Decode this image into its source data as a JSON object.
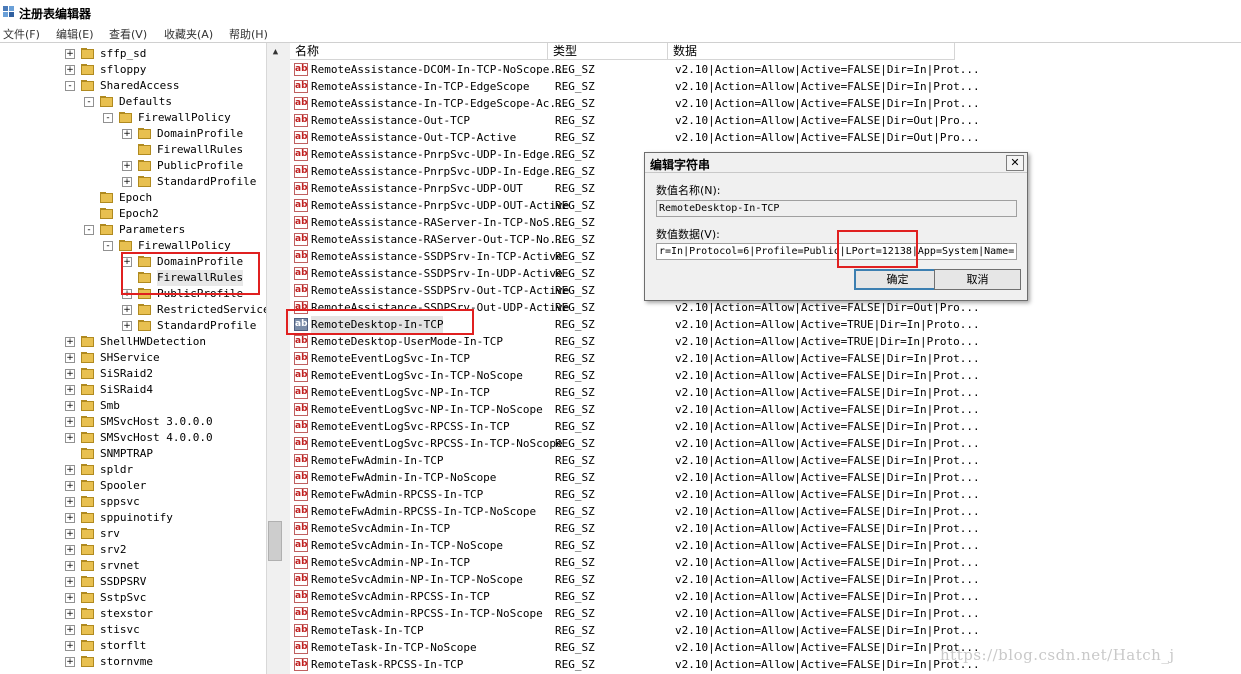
{
  "window": {
    "title": "注册表编辑器"
  },
  "menu": [
    {
      "label": "文件(F)"
    },
    {
      "label": "编辑(E)"
    },
    {
      "label": "查看(V)"
    },
    {
      "label": "收藏夹(A)"
    },
    {
      "label": "帮助(H)"
    }
  ],
  "tree": [
    {
      "label": "sffp_sd",
      "level": 0,
      "expander": "+"
    },
    {
      "label": "sfloppy",
      "level": 0,
      "expander": "+"
    },
    {
      "label": "SharedAccess",
      "level": 0,
      "expander": "-"
    },
    {
      "label": "Defaults",
      "level": 1,
      "expander": "-"
    },
    {
      "label": "FirewallPolicy",
      "level": 2,
      "expander": "-"
    },
    {
      "label": "DomainProfile",
      "level": 3,
      "expander": "+"
    },
    {
      "label": "FirewallRules",
      "level": 3,
      "expander": ""
    },
    {
      "label": "PublicProfile",
      "level": 3,
      "expander": "+"
    },
    {
      "label": "StandardProfile",
      "level": 3,
      "expander": "+"
    },
    {
      "label": "Epoch",
      "level": 1,
      "expander": ""
    },
    {
      "label": "Epoch2",
      "level": 1,
      "expander": ""
    },
    {
      "label": "Parameters",
      "level": 1,
      "expander": "-"
    },
    {
      "label": "FirewallPolicy",
      "level": 2,
      "expander": "-"
    },
    {
      "label": "DomainProfile",
      "level": 3,
      "expander": "+"
    },
    {
      "label": "FirewallRules",
      "level": 3,
      "expander": "",
      "selected": true
    },
    {
      "label": "PublicProfile",
      "level": 3,
      "expander": "+"
    },
    {
      "label": "RestrictedServices",
      "level": 3,
      "expander": "+"
    },
    {
      "label": "StandardProfile",
      "level": 3,
      "expander": "+"
    },
    {
      "label": "ShellHWDetection",
      "level": 0,
      "expander": "+"
    },
    {
      "label": "SHService",
      "level": 0,
      "expander": "+"
    },
    {
      "label": "SiSRaid2",
      "level": 0,
      "expander": "+"
    },
    {
      "label": "SiSRaid4",
      "level": 0,
      "expander": "+"
    },
    {
      "label": "Smb",
      "level": 0,
      "expander": "+"
    },
    {
      "label": "SMSvcHost 3.0.0.0",
      "level": 0,
      "expander": "+"
    },
    {
      "label": "SMSvcHost 4.0.0.0",
      "level": 0,
      "expander": "+"
    },
    {
      "label": "SNMPTRAP",
      "level": 0,
      "expander": ""
    },
    {
      "label": "spldr",
      "level": 0,
      "expander": "+"
    },
    {
      "label": "Spooler",
      "level": 0,
      "expander": "+"
    },
    {
      "label": "sppsvc",
      "level": 0,
      "expander": "+"
    },
    {
      "label": "sppuinotify",
      "level": 0,
      "expander": "+"
    },
    {
      "label": "srv",
      "level": 0,
      "expander": "+"
    },
    {
      "label": "srv2",
      "level": 0,
      "expander": "+"
    },
    {
      "label": "srvnet",
      "level": 0,
      "expander": "+"
    },
    {
      "label": "SSDPSRV",
      "level": 0,
      "expander": "+"
    },
    {
      "label": "SstpSvc",
      "level": 0,
      "expander": "+"
    },
    {
      "label": "stexstor",
      "level": 0,
      "expander": "+"
    },
    {
      "label": "stisvc",
      "level": 0,
      "expander": "+"
    },
    {
      "label": "storflt",
      "level": 0,
      "expander": "+"
    },
    {
      "label": "stornvme",
      "level": 0,
      "expander": "+"
    }
  ],
  "columns": {
    "name": "名称",
    "type": "类型",
    "data": "数据"
  },
  "values": [
    {
      "name": "RemoteAssistance-DCOM-In-TCP-NoScope...",
      "type": "REG_SZ",
      "data": "v2.10|Action=Allow|Active=FALSE|Dir=In|Prot..."
    },
    {
      "name": "RemoteAssistance-In-TCP-EdgeScope",
      "type": "REG_SZ",
      "data": "v2.10|Action=Allow|Active=FALSE|Dir=In|Prot..."
    },
    {
      "name": "RemoteAssistance-In-TCP-EdgeScope-Ac...",
      "type": "REG_SZ",
      "data": "v2.10|Action=Allow|Active=FALSE|Dir=In|Prot..."
    },
    {
      "name": "RemoteAssistance-Out-TCP",
      "type": "REG_SZ",
      "data": "v2.10|Action=Allow|Active=FALSE|Dir=Out|Pro..."
    },
    {
      "name": "RemoteAssistance-Out-TCP-Active",
      "type": "REG_SZ",
      "data": "v2.10|Action=Allow|Active=FALSE|Dir=Out|Pro..."
    },
    {
      "name": "RemoteAssistance-PnrpSvc-UDP-In-Edge...",
      "type": "REG_SZ",
      "data": ""
    },
    {
      "name": "RemoteAssistance-PnrpSvc-UDP-In-Edge...",
      "type": "REG_SZ",
      "data": ""
    },
    {
      "name": "RemoteAssistance-PnrpSvc-UDP-OUT",
      "type": "REG_SZ",
      "data": ""
    },
    {
      "name": "RemoteAssistance-PnrpSvc-UDP-OUT-Active",
      "type": "REG_SZ",
      "data": ""
    },
    {
      "name": "RemoteAssistance-RAServer-In-TCP-NoS...",
      "type": "REG_SZ",
      "data": ""
    },
    {
      "name": "RemoteAssistance-RAServer-Out-TCP-No...",
      "type": "REG_SZ",
      "data": ""
    },
    {
      "name": "RemoteAssistance-SSDPSrv-In-TCP-Active",
      "type": "REG_SZ",
      "data": ""
    },
    {
      "name": "RemoteAssistance-SSDPSrv-In-UDP-Active",
      "type": "REG_SZ",
      "data": ""
    },
    {
      "name": "RemoteAssistance-SSDPSrv-Out-TCP-Active",
      "type": "REG_SZ",
      "data": ""
    },
    {
      "name": "RemoteAssistance-SSDPSrv-Out-UDP-Active",
      "type": "REG_SZ",
      "data": "v2.10|Action=Allow|Active=FALSE|Dir=Out|Pro..."
    },
    {
      "name": "RemoteDesktop-In-TCP",
      "type": "REG_SZ",
      "data": "v2.10|Action=Allow|Active=TRUE|Dir=In|Proto...",
      "selected": true
    },
    {
      "name": "RemoteDesktop-UserMode-In-TCP",
      "type": "REG_SZ",
      "data": "v2.10|Action=Allow|Active=TRUE|Dir=In|Proto..."
    },
    {
      "name": "RemoteEventLogSvc-In-TCP",
      "type": "REG_SZ",
      "data": "v2.10|Action=Allow|Active=FALSE|Dir=In|Prot..."
    },
    {
      "name": "RemoteEventLogSvc-In-TCP-NoScope",
      "type": "REG_SZ",
      "data": "v2.10|Action=Allow|Active=FALSE|Dir=In|Prot..."
    },
    {
      "name": "RemoteEventLogSvc-NP-In-TCP",
      "type": "REG_SZ",
      "data": "v2.10|Action=Allow|Active=FALSE|Dir=In|Prot..."
    },
    {
      "name": "RemoteEventLogSvc-NP-In-TCP-NoScope",
      "type": "REG_SZ",
      "data": "v2.10|Action=Allow|Active=FALSE|Dir=In|Prot..."
    },
    {
      "name": "RemoteEventLogSvc-RPCSS-In-TCP",
      "type": "REG_SZ",
      "data": "v2.10|Action=Allow|Active=FALSE|Dir=In|Prot..."
    },
    {
      "name": "RemoteEventLogSvc-RPCSS-In-TCP-NoScope",
      "type": "REG_SZ",
      "data": "v2.10|Action=Allow|Active=FALSE|Dir=In|Prot..."
    },
    {
      "name": "RemoteFwAdmin-In-TCP",
      "type": "REG_SZ",
      "data": "v2.10|Action=Allow|Active=FALSE|Dir=In|Prot..."
    },
    {
      "name": "RemoteFwAdmin-In-TCP-NoScope",
      "type": "REG_SZ",
      "data": "v2.10|Action=Allow|Active=FALSE|Dir=In|Prot..."
    },
    {
      "name": "RemoteFwAdmin-RPCSS-In-TCP",
      "type": "REG_SZ",
      "data": "v2.10|Action=Allow|Active=FALSE|Dir=In|Prot..."
    },
    {
      "name": "RemoteFwAdmin-RPCSS-In-TCP-NoScope",
      "type": "REG_SZ",
      "data": "v2.10|Action=Allow|Active=FALSE|Dir=In|Prot..."
    },
    {
      "name": "RemoteSvcAdmin-In-TCP",
      "type": "REG_SZ",
      "data": "v2.10|Action=Allow|Active=FALSE|Dir=In|Prot..."
    },
    {
      "name": "RemoteSvcAdmin-In-TCP-NoScope",
      "type": "REG_SZ",
      "data": "v2.10|Action=Allow|Active=FALSE|Dir=In|Prot..."
    },
    {
      "name": "RemoteSvcAdmin-NP-In-TCP",
      "type": "REG_SZ",
      "data": "v2.10|Action=Allow|Active=FALSE|Dir=In|Prot..."
    },
    {
      "name": "RemoteSvcAdmin-NP-In-TCP-NoScope",
      "type": "REG_SZ",
      "data": "v2.10|Action=Allow|Active=FALSE|Dir=In|Prot..."
    },
    {
      "name": "RemoteSvcAdmin-RPCSS-In-TCP",
      "type": "REG_SZ",
      "data": "v2.10|Action=Allow|Active=FALSE|Dir=In|Prot..."
    },
    {
      "name": "RemoteSvcAdmin-RPCSS-In-TCP-NoScope",
      "type": "REG_SZ",
      "data": "v2.10|Action=Allow|Active=FALSE|Dir=In|Prot..."
    },
    {
      "name": "RemoteTask-In-TCP",
      "type": "REG_SZ",
      "data": "v2.10|Action=Allow|Active=FALSE|Dir=In|Prot..."
    },
    {
      "name": "RemoteTask-In-TCP-NoScope",
      "type": "REG_SZ",
      "data": "v2.10|Action=Allow|Active=FALSE|Dir=In|Prot..."
    },
    {
      "name": "RemoteTask-RPCSS-In-TCP",
      "type": "REG_SZ",
      "data": "v2.10|Action=Allow|Active=FALSE|Dir=In|Prot..."
    }
  ],
  "dialog": {
    "title": "编辑字符串",
    "close_glyph": "✕",
    "name_label": "数值名称(N):",
    "name_value": "RemoteDesktop-In-TCP",
    "data_label": "数值数据(V):",
    "data_value": "r=In|Protocol=6|Profile=Public|LPort=12138|App=System|Name=",
    "ok_label": "确定",
    "cancel_label": "取消"
  },
  "watermark": "https://blog.csdn.net/Hatch_j",
  "colors": {
    "highlight": "#e02020",
    "folder": "#e8c050",
    "icon_text": "#c02020"
  }
}
